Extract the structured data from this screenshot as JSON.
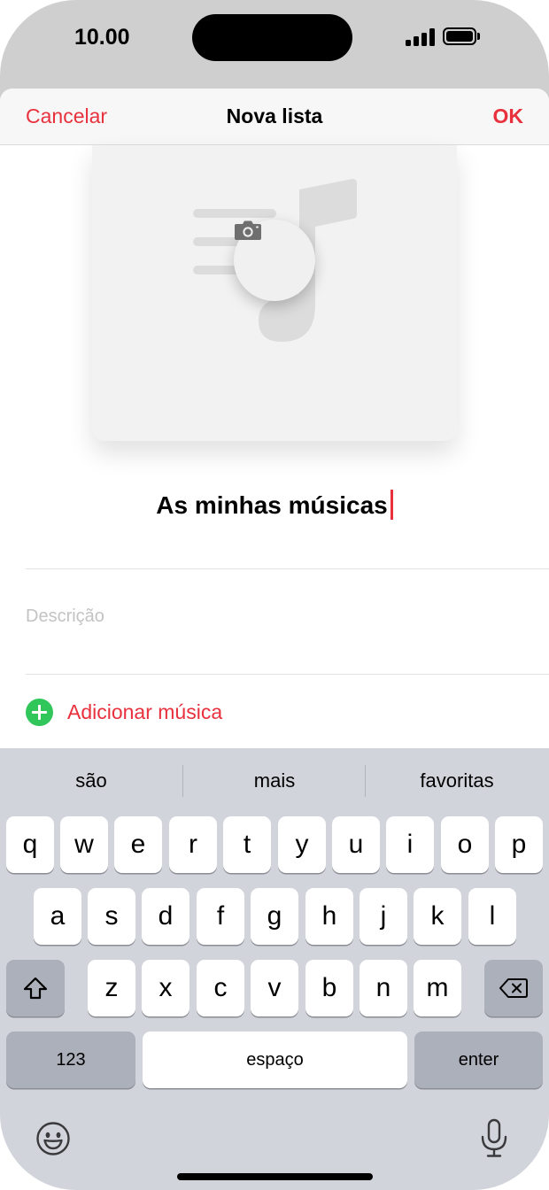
{
  "status_bar": {
    "time": "10.00"
  },
  "nav": {
    "cancel_label": "Cancelar",
    "title": "Nova lista",
    "ok_label": "OK"
  },
  "playlist": {
    "name": "As minhas músicas",
    "description_placeholder": "Descrição",
    "add_music_label": "Adicionar música"
  },
  "keyboard": {
    "suggestions": [
      "são",
      "mais",
      "favoritas"
    ],
    "row1": [
      "q",
      "w",
      "e",
      "r",
      "t",
      "y",
      "u",
      "i",
      "o",
      "p"
    ],
    "row2": [
      "a",
      "s",
      "d",
      "f",
      "g",
      "h",
      "j",
      "k",
      "l"
    ],
    "row3": [
      "z",
      "x",
      "c",
      "v",
      "b",
      "n",
      "m"
    ],
    "numbers_label": "123",
    "space_label": "espaço",
    "enter_label": "enter"
  },
  "colors": {
    "accent": "#e8313d",
    "add_green": "#30c65a",
    "keyboard_bg": "#d1d4db"
  },
  "icons": [
    "camera-icon",
    "music-note-icon",
    "plus-circle-icon",
    "shift-icon",
    "backspace-icon",
    "emoji-icon",
    "microphone-icon"
  ]
}
